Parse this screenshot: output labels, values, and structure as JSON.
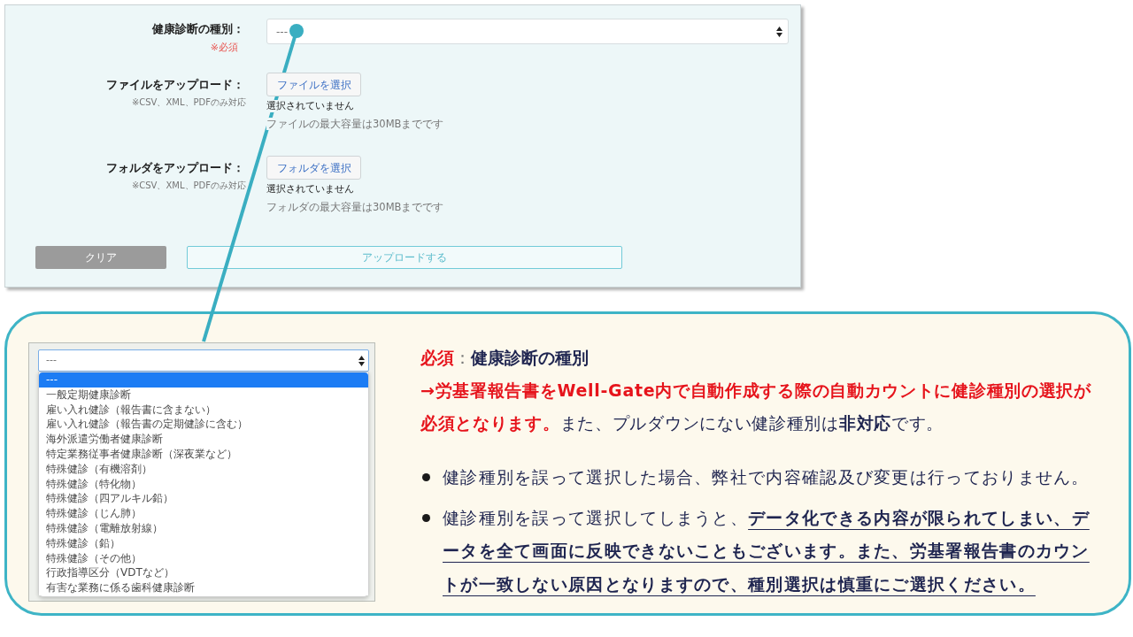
{
  "form": {
    "fields": [
      {
        "kind": "select",
        "label": "健康診断の種別：",
        "note": "※必須",
        "required": true,
        "value": "---"
      },
      {
        "kind": "file",
        "label": "ファイルをアップロード：",
        "note": "※CSV、XML、PDFのみ対応",
        "required": false,
        "button": "ファイルを選択",
        "status": "選択されていません",
        "hint": "ファイルの最大容量は30MBまでです"
      },
      {
        "kind": "file",
        "label": "フォルダをアップロード：",
        "note": "※CSV、XML、PDFのみ対応",
        "required": false,
        "button": "フォルダを選択",
        "status": "選択されていません",
        "hint": "フォルダの最大容量は30MBまでです"
      }
    ],
    "buttons": [
      {
        "kind": "clear",
        "label": "クリア"
      },
      {
        "kind": "upload",
        "label": "アップロードする"
      }
    ]
  },
  "callout": {
    "dropdown": {
      "value": "---",
      "options": [
        {
          "label": "---",
          "selected": true
        },
        {
          "label": "一般定期健康診断",
          "selected": false
        },
        {
          "label": "雇い入れ健診（報告書に含まない）",
          "selected": false
        },
        {
          "label": "雇い入れ健診（報告書の定期健診に含む）",
          "selected": false
        },
        {
          "label": "海外派遣労働者健康診断",
          "selected": false
        },
        {
          "label": "特定業務従事者健康診断（深夜業など）",
          "selected": false
        },
        {
          "label": "特殊健診（有機溶剤）",
          "selected": false
        },
        {
          "label": "特殊健診（特化物）",
          "selected": false
        },
        {
          "label": "特殊健診（四アルキル鉛）",
          "selected": false
        },
        {
          "label": "特殊健診（じん肺）",
          "selected": false
        },
        {
          "label": "特殊健診（電離放射線）",
          "selected": false
        },
        {
          "label": "特殊健診（鉛）",
          "selected": false
        },
        {
          "label": "特殊健診（その他）",
          "selected": false
        },
        {
          "label": "行政指導区分（VDTなど）",
          "selected": false
        },
        {
          "label": "有害な業務に係る歯科健康診断",
          "selected": false
        }
      ]
    },
    "heading": "**必須**：**健康診断の種別**",
    "description": "**→労基署報告書をWell-Gate内で自動作成する際の自動カウントに健診種別の選択が必須となります。**また、プルダウンにない健診種別は**非対応**です。",
    "bullets": [
      "健診種別を誤って選択した場合、弊社で内容確認及び変更は行っておりません。",
      "健診種別を誤って選択してしまうと、**データ化できる内容が限られてしまい、データを全て画面に反映できないこともございます。また、労基署報告書のカウントが一致しない原因となりますので、種別選択は慎重にご選択ください。**"
    ]
  }
}
